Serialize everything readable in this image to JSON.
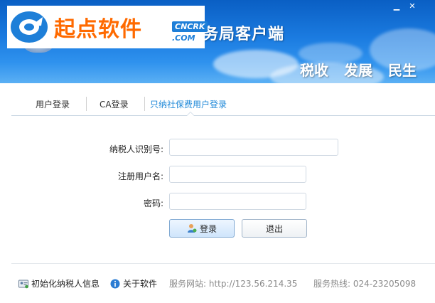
{
  "window": {
    "title": "务局客户端",
    "slogans": [
      "税收",
      "发展",
      "民生"
    ],
    "minimize_glyph": "▁",
    "close_glyph": "✕"
  },
  "watermark": {
    "text": "起点软件",
    "badge_top": "CNCRK",
    "badge_bottom": ".COM"
  },
  "tabs": [
    {
      "label": "用户登录",
      "active": false
    },
    {
      "label": "CA登录",
      "active": false
    },
    {
      "label": "只纳社保费用户登录",
      "active": true
    }
  ],
  "form": {
    "taxpayer_id_label": "纳税人识别号:",
    "taxpayer_id_value": "",
    "username_label": "注册用户名:",
    "username_value": "",
    "password_label": "密码:",
    "password_value": "",
    "login_button": "登录",
    "exit_button": "退出"
  },
  "footer": {
    "init_link": "初始化纳税人信息",
    "about_link": "关于软件",
    "service_site": "服务网站: http://123.56.214.35",
    "service_hotline": "服务热线: 024-23205098"
  },
  "icons": {
    "login_button_icon": "user-icon",
    "init_icon": "id-card-icon",
    "about_icon": "info-icon"
  },
  "colors": {
    "banner_top": "#0a5fc4",
    "banner_bottom": "#5bb0f4",
    "active_tab": "#1e88d8",
    "watermark_orange": "#ff6a00",
    "watermark_blue": "#1e7fd8"
  }
}
